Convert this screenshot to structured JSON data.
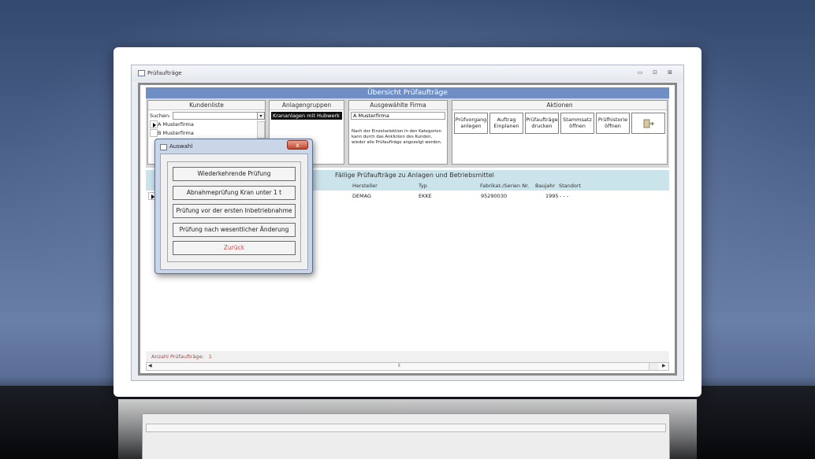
{
  "window": {
    "title": "Prüfaufträge"
  },
  "form": {
    "title": "Übersicht Prüfaufträge"
  },
  "kundenliste": {
    "header": "Kundenliste",
    "search_label": "Suchen:",
    "items": [
      "A Musterfirma",
      "B Musterfirma"
    ]
  },
  "anlagengruppen": {
    "header": "Anlagengruppen",
    "selected_item": "Krananlagen mit Hubwerk"
  },
  "ausgewaehlte_firma": {
    "header": "Ausgewählte Firma",
    "value": "A Musterfirma",
    "hint": "Nach der Einzelselektion in den Kategorien kann durch das Anklicken des Kunden, wieder alle Prüfaufträge angezeigt werden."
  },
  "aktionen": {
    "header": "Aktionen",
    "buttons": [
      {
        "line1": "Prüfvorgang",
        "line2": "anlegen"
      },
      {
        "line1": "Auftrag",
        "line2": "Einplanen"
      },
      {
        "line1": "Prüfaufträge",
        "line2": "drucken"
      },
      {
        "line1": "Stammsatz",
        "line2": "öffnen"
      },
      {
        "line1": "Prüfhistorie",
        "line2": "öffnen"
      }
    ]
  },
  "faellige": {
    "title": "Fällige Prüfaufträge zu Anlagen und Betriebsmittel",
    "columns": {
      "hersteller": "Hersteller",
      "typ": "Typ",
      "fabrikat": "Fabrikat-/Serien Nr.",
      "baujahr": "Baujahr",
      "standort": "Standort"
    },
    "rows": [
      {
        "hersteller": "DEMAG",
        "typ": "EKKE",
        "fabrikat": "95290030",
        "baujahr": "1995",
        "standort": "- - -"
      }
    ]
  },
  "footer": {
    "label": "Anzahl Prüfaufträge:",
    "count": "1"
  },
  "dialog": {
    "title": "Auswahl",
    "close_label": "x",
    "buttons": [
      "Wiederkehrende Prüfung",
      "Abnahmeprüfung Kran unter 1 t",
      "Prüfung vor der ersten Inbetriebnahme",
      "Prüfung nach wesentlicher Änderung",
      "Zurück"
    ]
  },
  "colors": {
    "title_bar_blue": "#6e8ec4",
    "section_blue": "#cbe3ea",
    "zurueck_red": "#c0504d"
  }
}
